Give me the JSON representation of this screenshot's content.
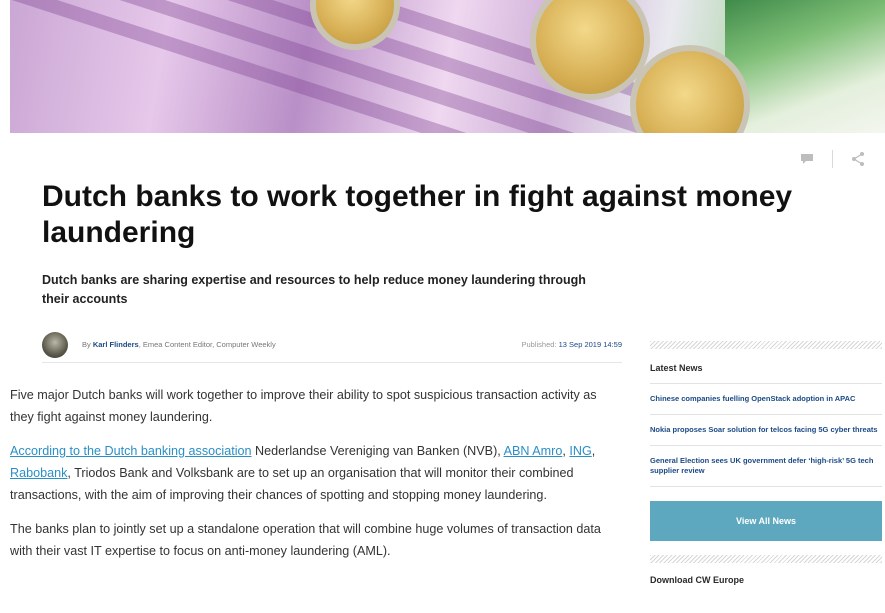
{
  "article": {
    "headline": "Dutch banks to work together in fight against money laundering",
    "subheadline": "Dutch banks are sharing expertise and resources to help reduce money laundering through their accounts",
    "byline_prefix": "By ",
    "author": "Karl Flinders",
    "author_role": ", Emea Content Editor, Computer Weekly",
    "published_label": "Published: ",
    "published_date": "13 Sep 2019 14:59",
    "paragraphs": {
      "p1": "Five major Dutch banks will work together to improve their ability to spot suspicious transaction activity as they fight against money laundering.",
      "p2_link1": "According to the Dutch banking association",
      "p2_text1": " Nederlandse Vereniging van Banken (NVB), ",
      "p2_link2": "ABN Amro",
      "p2_sep1": ", ",
      "p2_link3": "ING",
      "p2_sep2": ", ",
      "p2_link4": "Rabobank",
      "p2_text2": ", Triodos Bank and Volksbank are to set up an organisation that will monitor their combined transactions, with the aim of improving their chances of spotting and stopping money laundering.",
      "p3": "The banks plan to jointly set up a standalone operation that will combine huge volumes of transaction data with their vast IT expertise to focus on anti-money laundering (AML)."
    }
  },
  "actions": {
    "comment_icon": "comment-icon",
    "share_icon": "share-icon"
  },
  "sidebar": {
    "latest_title": "Latest News",
    "news": [
      "Chinese companies fuelling OpenStack adoption in APAC",
      "Nokia proposes Soar solution for telcos facing 5G cyber threats",
      "General Election sees UK government defer ‘high-risk’ 5G tech supplier review"
    ],
    "view_all_label": "View All News",
    "download_title": "Download CW Europe"
  },
  "colors": {
    "link": "#2a8fc7",
    "author": "#1b4a86",
    "button": "#5da8bf"
  }
}
